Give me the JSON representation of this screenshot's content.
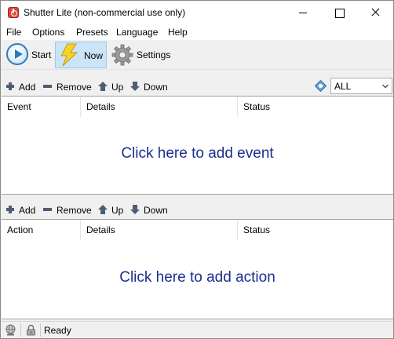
{
  "window": {
    "title": "Shutter Lite (non-commercial use only)"
  },
  "menu": [
    "File",
    "Options",
    "Presets",
    "Language",
    "Help"
  ],
  "toolbar": {
    "start_label": "Start",
    "now_label": "Now",
    "settings_label": "Settings"
  },
  "events_toolbar": {
    "add": "Add",
    "remove": "Remove",
    "up": "Up",
    "down": "Down",
    "filter_value": "ALL"
  },
  "events_list": {
    "columns": [
      "Event",
      "Details",
      "Status"
    ],
    "empty_text": "Click here to add event"
  },
  "actions_toolbar": {
    "add": "Add",
    "remove": "Remove",
    "up": "Up",
    "down": "Down"
  },
  "actions_list": {
    "columns": [
      "Action",
      "Details",
      "Status"
    ],
    "empty_text": "Click here to add action"
  },
  "status": {
    "text": "Ready"
  },
  "colors": {
    "link": "#1c2f8f",
    "selected_tool_bg": "#cce4f7",
    "icon_blue": "#2e7bbf",
    "now_icon_yellow": "#f6d328"
  }
}
